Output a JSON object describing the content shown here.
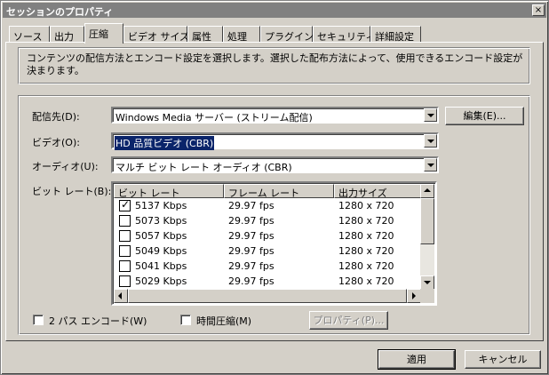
{
  "window": {
    "title": "セッションのプロパティ",
    "close_glyph": "×"
  },
  "tabs": [
    {
      "label": "ソース"
    },
    {
      "label": "出力"
    },
    {
      "label": "圧縮",
      "active": true
    },
    {
      "label": "ビデオ サイズ"
    },
    {
      "label": "属性"
    },
    {
      "label": "処理"
    },
    {
      "label": "プラグイン"
    },
    {
      "label": "セキュリティ"
    },
    {
      "label": "詳細設定"
    }
  ],
  "description": {
    "line1": "コンテンツの配信方法とエンコード設定を選択します。選択した配布方法によって、使用できるエンコード設定が",
    "line2": "決まります。"
  },
  "fields": {
    "destination": {
      "label": "配信先(D):",
      "value": "Windows Media サーバー (ストリーム配信)"
    },
    "edit_button": "編集(E)...",
    "video": {
      "label": "ビデオ(O):",
      "value": "HD 品質ビデオ (CBR)"
    },
    "audio": {
      "label": "オーディオ(U):",
      "value": "マルチ ビット レート オーディオ (CBR)"
    },
    "bitrate": {
      "label": "ビット レート(B):"
    }
  },
  "bitrate_table": {
    "columns": [
      "ビット レート",
      "フレーム レート",
      "出力サイズ"
    ],
    "rows": [
      {
        "bitrate": "5137 Kbps",
        "frame_rate": "29.97 fps",
        "size": "1280 x 720",
        "checked": true
      },
      {
        "bitrate": "5073 Kbps",
        "frame_rate": "29.97 fps",
        "size": "1280 x 720",
        "checked": false
      },
      {
        "bitrate": "5057 Kbps",
        "frame_rate": "29.97 fps",
        "size": "1280 x 720",
        "checked": false
      },
      {
        "bitrate": "5049 Kbps",
        "frame_rate": "29.97 fps",
        "size": "1280 x 720",
        "checked": false
      },
      {
        "bitrate": "5041 Kbps",
        "frame_rate": "29.97 fps",
        "size": "1280 x 720",
        "checked": false
      },
      {
        "bitrate": "5029 Kbps",
        "frame_rate": "29.97 fps",
        "size": "1280 x 720",
        "checked": false
      }
    ],
    "check_glyph": "✓"
  },
  "options": {
    "two_pass": "2 パス エンコード(W)",
    "time_compression": "時間圧縮(M)",
    "properties_button": "プロパティ(P)..."
  },
  "footer": {
    "apply": "適用",
    "cancel": "キャンセル"
  }
}
